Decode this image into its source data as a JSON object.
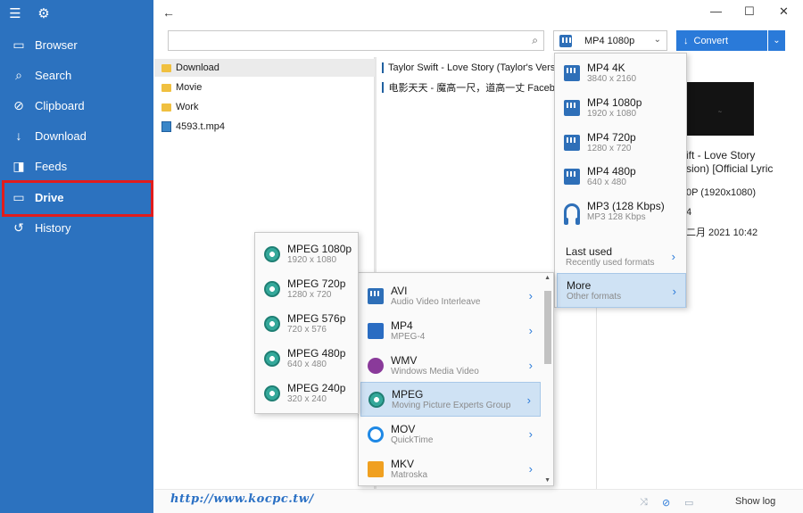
{
  "sidebar": {
    "items": [
      {
        "label": "Browser",
        "icon": "browser-icon"
      },
      {
        "label": "Search",
        "icon": "search-icon"
      },
      {
        "label": "Clipboard",
        "icon": "clipboard-icon"
      },
      {
        "label": "Download",
        "icon": "download-icon"
      },
      {
        "label": "Feeds",
        "icon": "feeds-icon"
      },
      {
        "label": "Drive",
        "icon": "folder-icon"
      },
      {
        "label": "History",
        "icon": "history-icon"
      }
    ],
    "active": "Drive",
    "highlight_color": "#e11c1c",
    "bg_color": "#2c72bf"
  },
  "toolbar": {
    "search_value": "",
    "format_selected": "MP4 1080p",
    "convert_label": "Convert"
  },
  "files": [
    {
      "name": "Download",
      "type": "folder"
    },
    {
      "name": "Movie",
      "type": "folder"
    },
    {
      "name": "Work",
      "type": "folder"
    },
    {
      "name": "4593.t.mp4",
      "type": "video"
    }
  ],
  "queue": [
    {
      "title": "Taylor Swift - Love Story (Taylor's Version"
    },
    {
      "title": "电影天天 - 魔高一尺，道高一丈  Facebo"
    }
  ],
  "details": {
    "title_line1": "ift - Love Story",
    "title_line2": "sion) [Official Lyric",
    "resolution": "0P (1920x1080)",
    "line_four": "4",
    "date": "二月 2021 10:42"
  },
  "format_menu": {
    "items": [
      {
        "main": "MP4 4K",
        "sub": "3840 x 2160",
        "icon": "film-icon"
      },
      {
        "main": "MP4 1080p",
        "sub": "1920 x 1080",
        "icon": "film-icon"
      },
      {
        "main": "MP4 720p",
        "sub": "1280 x 720",
        "icon": "film-icon"
      },
      {
        "main": "MP4 480p",
        "sub": "640 x 480",
        "icon": "film-icon"
      },
      {
        "main": "MP3 (128 Kbps)",
        "sub": "MP3 128 Kbps",
        "icon": "headphones-icon"
      }
    ],
    "last_used": {
      "main": "Last used",
      "sub": "Recently used formats"
    },
    "more": {
      "main": "More",
      "sub": "Other formats"
    }
  },
  "more_menu": {
    "items": [
      {
        "main": "AVI",
        "sub": "Audio Video Interleave",
        "icon": "film-icon"
      },
      {
        "main": "MP4",
        "sub": "MPEG-4",
        "icon": "film-icon"
      },
      {
        "main": "WMV",
        "sub": "Windows Media Video",
        "icon": "wmv-icon"
      },
      {
        "main": "MPEG",
        "sub": "Moving Picture Experts Group",
        "icon": "disc-icon"
      },
      {
        "main": "MOV",
        "sub": "QuickTime",
        "icon": "quicktime-icon"
      },
      {
        "main": "MKV",
        "sub": "Matroska",
        "icon": "mkv-icon"
      }
    ]
  },
  "mpeg_menu": {
    "items": [
      {
        "main": "MPEG 1080p",
        "sub": "1920 x 1080"
      },
      {
        "main": "MPEG 720p",
        "sub": "1280 x 720"
      },
      {
        "main": "MPEG 576p",
        "sub": "720 x 576"
      },
      {
        "main": "MPEG 480p",
        "sub": "640 x 480"
      },
      {
        "main": "MPEG 240p",
        "sub": "320 x 240"
      }
    ]
  },
  "bottom": {
    "show_log": "Show log",
    "watermark": "http://www.kocpc.tw/"
  }
}
